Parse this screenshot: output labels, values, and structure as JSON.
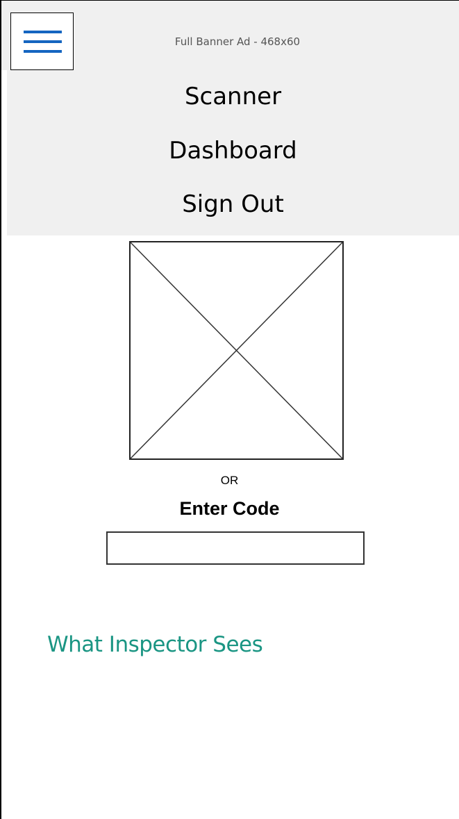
{
  "header": {
    "menu_icon": "hamburger-menu-icon",
    "ad_label": "Full Banner Ad - 468x60"
  },
  "menu": {
    "items": [
      {
        "label": "Scanner"
      },
      {
        "label": "Dashboard"
      },
      {
        "label": "Sign Out"
      }
    ]
  },
  "scanner": {
    "image_placeholder_icon": "image-placeholder-icon",
    "or_label": "OR",
    "enter_code_label": "Enter Code",
    "code_value": "",
    "code_placeholder": ""
  },
  "link": {
    "label": "What Inspector Sees"
  },
  "colors": {
    "accent_blue": "#1565c0",
    "link_teal": "#1a9583",
    "panel_bg": "#f0f0f0"
  }
}
